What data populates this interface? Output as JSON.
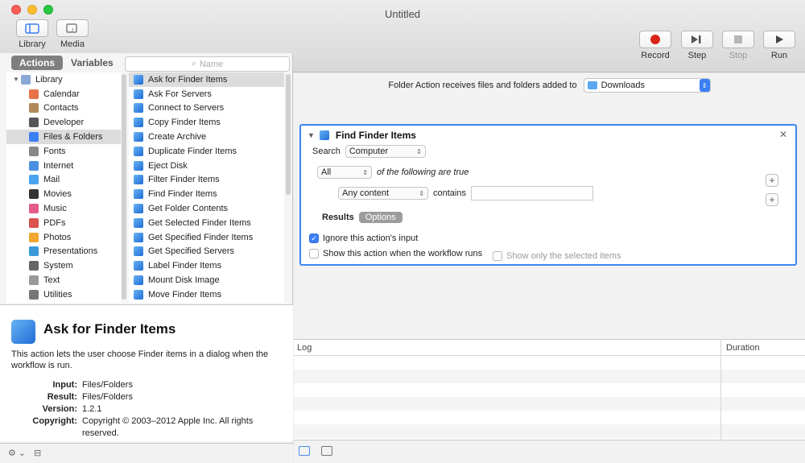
{
  "window": {
    "title": "Untitled"
  },
  "toolbar": {
    "library_label": "Library",
    "media_label": "Media",
    "record_label": "Record",
    "step_label": "Step",
    "stop_label": "Stop",
    "run_label": "Run"
  },
  "left": {
    "tabs": {
      "actions": "Actions",
      "variables": "Variables"
    },
    "search_placeholder": "Name",
    "library": {
      "root": "Library",
      "items": [
        {
          "label": "Calendar",
          "color": "#e8734a"
        },
        {
          "label": "Contacts",
          "color": "#b08a5a"
        },
        {
          "label": "Developer",
          "color": "#555555"
        },
        {
          "label": "Files & Folders",
          "color": "#3b7ff5"
        },
        {
          "label": "Fonts",
          "color": "#888888"
        },
        {
          "label": "Internet",
          "color": "#4a90e2"
        },
        {
          "label": "Mail",
          "color": "#4aa3f0"
        },
        {
          "label": "Movies",
          "color": "#333333"
        },
        {
          "label": "Music",
          "color": "#e55b8c"
        },
        {
          "label": "PDFs",
          "color": "#d9534f"
        },
        {
          "label": "Photos",
          "color": "#f0a830"
        },
        {
          "label": "Presentations",
          "color": "#3a9ad9"
        },
        {
          "label": "System",
          "color": "#666666"
        },
        {
          "label": "Text",
          "color": "#999999"
        },
        {
          "label": "Utilities",
          "color": "#777777"
        }
      ]
    },
    "actions": [
      "Ask for Finder Items",
      "Ask For Servers",
      "Connect to Servers",
      "Copy Finder Items",
      "Create Archive",
      "Duplicate Finder Items",
      "Eject Disk",
      "Filter Finder Items",
      "Find Finder Items",
      "Get Folder Contents",
      "Get Selected Finder Items",
      "Get Specified Finder Items",
      "Get Specified Servers",
      "Label Finder Items",
      "Mount Disk Image",
      "Move Finder Items"
    ],
    "description": {
      "title": "Ask for Finder Items",
      "text": "This action lets the user choose Finder items in a dialog when the workflow is run.",
      "input_label": "Input:",
      "input_value": "Files/Folders",
      "result_label": "Result:",
      "result_value": "Files/Folders",
      "version_label": "Version:",
      "version_value": "1.2.1",
      "copyright_label": "Copyright:",
      "copyright_value": "Copyright © 2003–2012 Apple Inc. All rights reserved."
    }
  },
  "right": {
    "folder_action_label": "Folder Action receives files and folders added to",
    "folder_value": "Downloads",
    "action": {
      "title": "Find Finder Items",
      "search_label": "Search",
      "search_value": "Computer",
      "all_value": "All",
      "following_text": "of the following are true",
      "content_value": "Any content",
      "contains_label": "contains",
      "results_tab": "Results",
      "options_tab": "Options",
      "ignore_input": "Ignore this action's input",
      "show_action": "Show this action when the workflow runs",
      "show_selected": "Show only the selected items"
    },
    "log": {
      "col_log": "Log",
      "col_duration": "Duration"
    }
  }
}
